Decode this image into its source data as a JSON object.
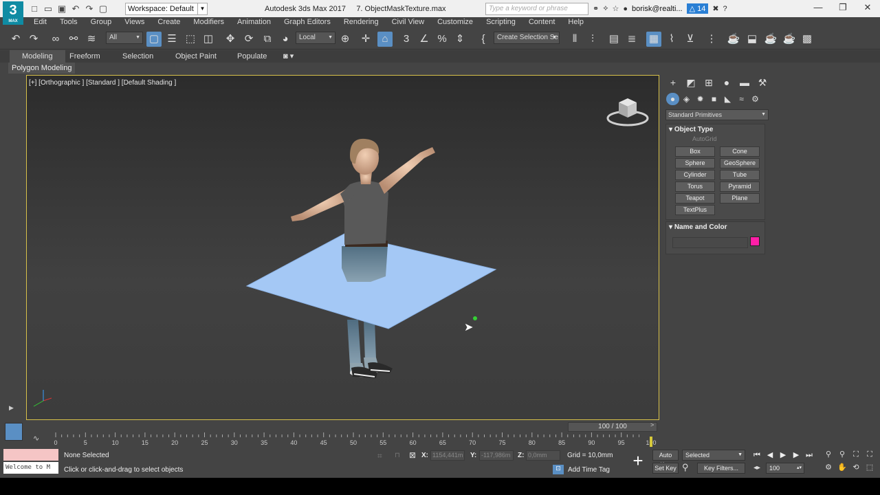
{
  "app": {
    "logo_number": "3",
    "logo_sub": "MAX",
    "workspace": "Workspace: Default",
    "title": "Autodesk 3ds Max 2017",
    "file_name": "7. ObjectMaskTexture.max",
    "search_placeholder": "Type a keyword or phrase",
    "user": "borisk@realti...",
    "notification_count": "14"
  },
  "menu": [
    "Edit",
    "Tools",
    "Group",
    "Views",
    "Create",
    "Modifiers",
    "Animation",
    "Graph Editors",
    "Rendering",
    "Civil View",
    "Customize",
    "Scripting",
    "Content",
    "Help"
  ],
  "toolbar": {
    "filter": "All",
    "reference_coord": "Local",
    "selection_set": "Create Selection Se"
  },
  "ribbon": {
    "tabs": [
      "Modeling",
      "Freeform",
      "Selection",
      "Object Paint",
      "Populate"
    ],
    "active_tab": "Modeling",
    "panel": "Polygon Modeling"
  },
  "viewport": {
    "label": "[+] [Orthographic ] [Standard ] [Default Shading ]"
  },
  "command_panel": {
    "category": "Standard Primitives",
    "object_type_title": "Object Type",
    "autogrid_label": "AutoGrid",
    "buttons": [
      "Box",
      "Cone",
      "Sphere",
      "GeoSphere",
      "Cylinder",
      "Tube",
      "Torus",
      "Pyramid",
      "Teapot",
      "Plane",
      "TextPlus"
    ],
    "name_color_title": "Name and Color",
    "object_color": "#ff1fa7"
  },
  "timeline": {
    "frame_display": "100 / 100",
    "current_frame": 100,
    "total_frames": 100,
    "tick_labels": [
      "0",
      "5",
      "10",
      "15",
      "20",
      "25",
      "30",
      "35",
      "40",
      "45",
      "50",
      "55",
      "60",
      "65",
      "70",
      "75",
      "80",
      "85",
      "90",
      "95",
      "100"
    ]
  },
  "status": {
    "maxscript": "Welcome to M",
    "selection": "None Selected",
    "prompt": "Click or click-and-drag to select objects",
    "x_label": "X:",
    "x_value": "1154,441m",
    "y_label": "Y:",
    "y_value": "-117,986m",
    "z_label": "Z:",
    "z_value": "0,0mm",
    "grid": "Grid = 10,0mm",
    "add_time_tag": "Add Time Tag",
    "auto_key": "Auto Key",
    "set_key": "Set Key",
    "key_mode": "Selected",
    "key_filters": "Key Filters...",
    "frame_field": "100"
  },
  "colors": {
    "accent": "#5a8fc4",
    "viewport_border": "#d9c24a",
    "plane": "#a4c8f5"
  }
}
